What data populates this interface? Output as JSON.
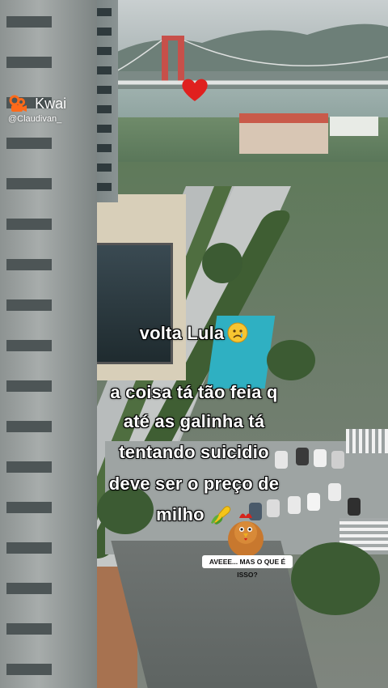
{
  "watermark": {
    "brand": "Kwai",
    "handle": "@Claudivan_"
  },
  "caption": {
    "line_1": "volta Lula",
    "line_2": "a coisa tá tão feia q",
    "line_3": "até as galinha tá",
    "line_4": "tentando suicidio",
    "line_5": "deve ser o preço de",
    "line_6": "milho"
  },
  "sticker": {
    "text": "AVEEE... MAS O QUE É ISSO?"
  },
  "icons": {
    "heart": "red-heart-icon",
    "kwai_logo": "kwai-logo-icon",
    "sad_face": "sad-face-emoji-icon",
    "corn": "corn-emoji-icon",
    "chicken": "chicken-icon"
  },
  "colors": {
    "heart": "#e0201e",
    "kwai_orange": "#ff6a1a",
    "caption_text": "#ffffff",
    "pool_roof": "#2fb0c2"
  }
}
